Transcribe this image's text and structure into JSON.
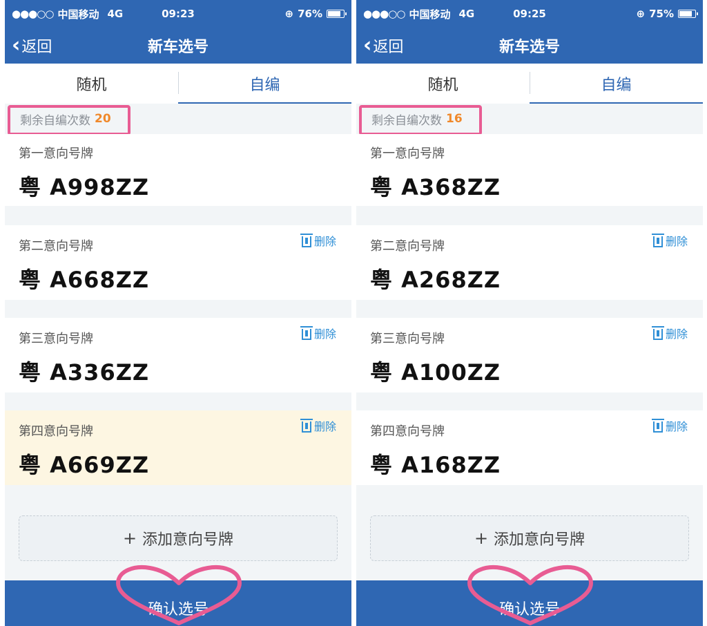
{
  "screens": [
    {
      "status": {
        "signal": "●●●○○",
        "carrier": "中国移动",
        "network": "4G",
        "time": "09:23",
        "battery_pct": "76%",
        "battery_level": 0.76
      },
      "nav": {
        "back_label": "返回",
        "title": "新车选号"
      },
      "tabs": [
        {
          "label": "随机",
          "active": false
        },
        {
          "label": "自编",
          "active": true
        }
      ],
      "remaining": {
        "label": "剩余自编次数",
        "count": "20"
      },
      "plates": [
        {
          "label": "第一意向号牌",
          "number": "粤 A998ZZ",
          "deletable": false,
          "highlight": false
        },
        {
          "label": "第二意向号牌",
          "number": "粤 A668ZZ",
          "deletable": true,
          "highlight": false
        },
        {
          "label": "第三意向号牌",
          "number": "粤 A336ZZ",
          "deletable": true,
          "highlight": false
        },
        {
          "label": "第四意向号牌",
          "number": "粤 A669ZZ",
          "deletable": true,
          "highlight": true
        }
      ],
      "delete_label": "删除",
      "add_label": "添加意向号牌",
      "confirm_label": "确认选号"
    },
    {
      "status": {
        "signal": "●●●○○",
        "carrier": "中国移动",
        "network": "4G",
        "time": "09:25",
        "battery_pct": "75%",
        "battery_level": 0.75
      },
      "nav": {
        "back_label": "返回",
        "title": "新车选号"
      },
      "tabs": [
        {
          "label": "随机",
          "active": false
        },
        {
          "label": "自编",
          "active": true
        }
      ],
      "remaining": {
        "label": "剩余自编次数",
        "count": "16"
      },
      "plates": [
        {
          "label": "第一意向号牌",
          "number": "粤 A368ZZ",
          "deletable": false,
          "highlight": false
        },
        {
          "label": "第二意向号牌",
          "number": "粤 A268ZZ",
          "deletable": true,
          "highlight": false
        },
        {
          "label": "第三意向号牌",
          "number": "粤 A100ZZ",
          "deletable": true,
          "highlight": false
        },
        {
          "label": "第四意向号牌",
          "number": "粤 A168ZZ",
          "deletable": true,
          "highlight": false
        }
      ],
      "delete_label": "删除",
      "add_label": "添加意向号牌",
      "confirm_label": "确认选号"
    }
  ],
  "colors": {
    "primary": "#2f67b3",
    "accent_count": "#f0892b",
    "annotation": "#e85c93",
    "delete": "#2f8fd6",
    "highlight_row": "#fdf6e2"
  }
}
